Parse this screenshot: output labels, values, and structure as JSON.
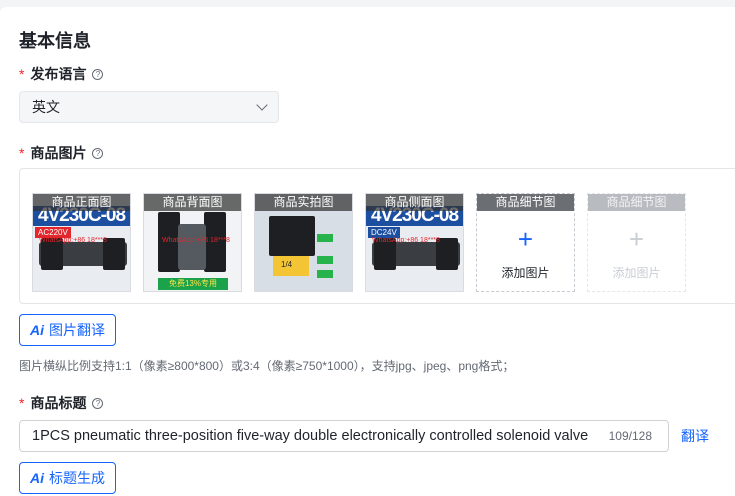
{
  "section": {
    "title": "基本信息"
  },
  "language": {
    "required_mark": "*",
    "label": "发布语言",
    "selected": "英文"
  },
  "images": {
    "required_mark": "*",
    "label": "商品图片",
    "thumbnails": [
      {
        "caption": "商品正面图",
        "banner": "4V230C-08",
        "tag": "AC220V",
        "tag_color": "#e2262b",
        "contact": "WhatsApp:+86 18***8"
      },
      {
        "caption": "商品背面图",
        "contact": "WhatsApp:+86 18***8",
        "footer": "免费13%专用"
      },
      {
        "caption": "商品实拍图",
        "label": "1/4"
      },
      {
        "caption": "商品侧面图",
        "banner": "4V230C-08",
        "tag": "DC24V",
        "tag_color": "#1d4fa0",
        "contact": "WhatsApp:+86 18***8"
      }
    ],
    "add_slots": [
      {
        "caption": "商品细节图",
        "plus": "+",
        "text": "添加图片",
        "enabled": true
      },
      {
        "caption": "商品细节图",
        "plus": "+",
        "text": "添加图片",
        "enabled": false
      }
    ],
    "translate_button": "图片翻译",
    "ai_mark": "Ai",
    "hint": "图片横纵比例支持1:1（像素≥800*800）或3:4（像素≥750*1000），支持jpg、jpeg、png格式；"
  },
  "product_title": {
    "required_mark": "*",
    "label": "商品标题",
    "value": "1PCS pneumatic three-position five-way double electronically controlled solenoid valve",
    "counter": "109/128",
    "translate_link": "翻译",
    "generate_button": "标题生成",
    "ai_mark": "Ai"
  },
  "colors": {
    "accent": "#1664ff",
    "required": "#f5222d",
    "banner": "#1d4fa0"
  }
}
